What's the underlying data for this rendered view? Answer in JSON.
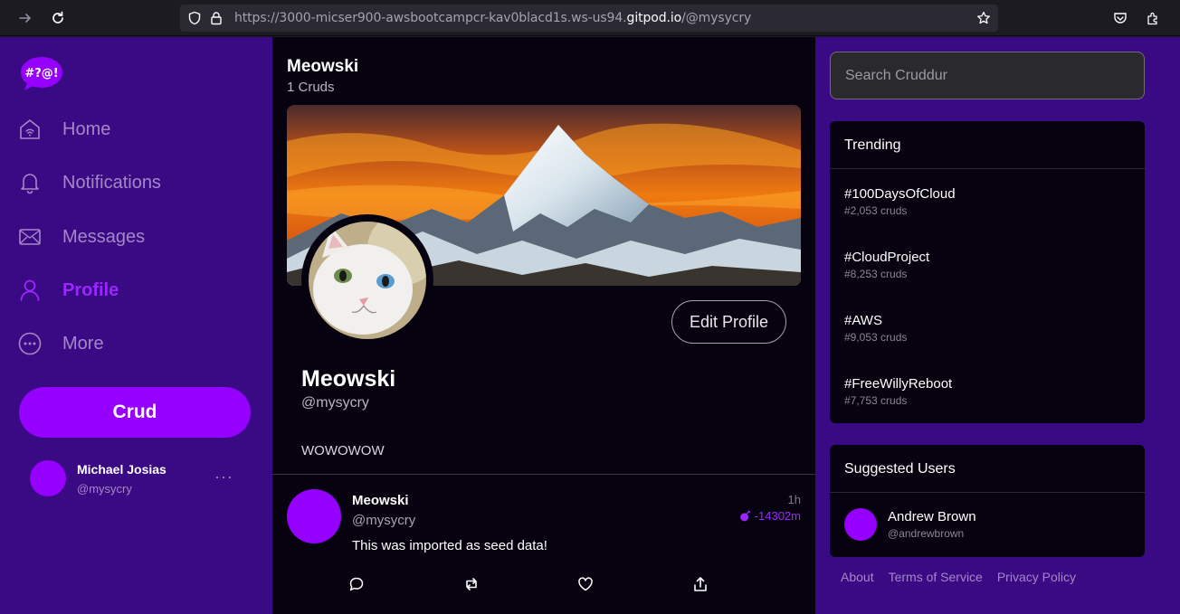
{
  "browser": {
    "url_prefix": "https://3000-micser900-awsbootcampcr-kav0blacd1s.ws-us94.",
    "url_domain": "gitpod.io",
    "url_suffix": "/@mysycry"
  },
  "sidebar": {
    "logo_text": "#?@!",
    "items": [
      {
        "label": "Home",
        "icon": "home-icon"
      },
      {
        "label": "Notifications",
        "icon": "bell-icon"
      },
      {
        "label": "Messages",
        "icon": "envelope-icon"
      },
      {
        "label": "Profile",
        "icon": "person-icon"
      },
      {
        "label": "More",
        "icon": "more-circle-icon"
      }
    ],
    "crud_label": "Crud",
    "user": {
      "name": "Michael Josias",
      "handle": "@mysycry",
      "more": "···"
    }
  },
  "main": {
    "display_name": "Meowski",
    "cruds_count": "1 Cruds",
    "edit_profile_label": "Edit Profile",
    "profile": {
      "name": "Meowski",
      "handle": "@mysycry",
      "bio": "WOWOWOW"
    },
    "post": {
      "name": "Meowski",
      "handle": "@mysycry",
      "text": "This was imported as seed data!",
      "time": "1h",
      "expires": "-14302m"
    }
  },
  "right": {
    "search_placeholder": "Search Cruddur",
    "trending_title": "Trending",
    "trending": [
      {
        "tag": "#100DaysOfCloud",
        "count": "#2,053 cruds"
      },
      {
        "tag": "#CloudProject",
        "count": "#8,253 cruds"
      },
      {
        "tag": "#AWS",
        "count": "#9,053 cruds"
      },
      {
        "tag": "#FreeWillyReboot",
        "count": "#7,753 cruds"
      }
    ],
    "suggested_title": "Suggested Users",
    "suggested": [
      {
        "name": "Andrew Brown",
        "handle": "@andrewbrown"
      }
    ],
    "footer": [
      "About",
      "Terms of Service",
      "Privacy Policy"
    ]
  },
  "colors": {
    "accent": "#9500ff",
    "sidebar_bg": "#3a0a84",
    "main_bg": "#07020f"
  }
}
